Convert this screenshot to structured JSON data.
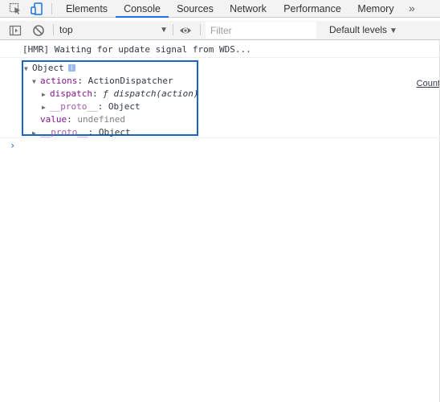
{
  "tabs": {
    "items": [
      {
        "label": "Elements"
      },
      {
        "label": "Console",
        "active": true
      },
      {
        "label": "Sources"
      },
      {
        "label": "Network"
      },
      {
        "label": "Performance"
      },
      {
        "label": "Memory"
      }
    ],
    "more": "»"
  },
  "toolbar": {
    "context": "top",
    "filter_placeholder": "Filter",
    "levels": "Default levels"
  },
  "console": {
    "hmr_message": "[HMR] Waiting for update signal from WDS...",
    "source_link": "Count",
    "object": {
      "label": "Object",
      "info": "i",
      "actions_key": "actions",
      "actions_value": "ActionDispatcher",
      "dispatch_key": "dispatch",
      "dispatch_value": "ƒ dispatch(action)",
      "proto_key": "__proto__",
      "proto_value": "Object",
      "value_key": "value",
      "value_value": "undefined",
      "proto2_key": "__proto__",
      "proto2_value": "Object"
    },
    "prompt": "›"
  },
  "colors": {
    "highlight_border": "#1a63c9",
    "active_tab": "#1a73e8",
    "key_purple": "#881391"
  }
}
